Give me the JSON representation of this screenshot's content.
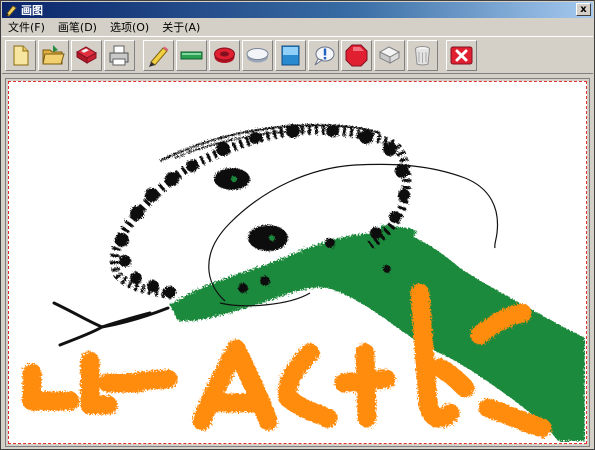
{
  "window": {
    "title": "画图",
    "close_label": "x",
    "app_icon": "brush-icon"
  },
  "menubar": {
    "items": [
      {
        "label": "文件(F)",
        "name": "menu-file"
      },
      {
        "label": "画笔(D)",
        "name": "menu-pen"
      },
      {
        "label": "选项(O)",
        "name": "menu-options"
      },
      {
        "label": "关于(A)",
        "name": "menu-about"
      }
    ]
  },
  "toolbar": {
    "buttons": [
      {
        "icon": "new-file-icon",
        "name": "new-button"
      },
      {
        "icon": "open-folder-icon",
        "name": "open-button"
      },
      {
        "icon": "save-disk-icon",
        "name": "save-button"
      },
      {
        "icon": "print-icon",
        "name": "print-button"
      },
      {
        "icon": "pencil-icon",
        "name": "pencil-tool-button"
      },
      {
        "icon": "line-icon",
        "name": "line-tool-button"
      },
      {
        "icon": "ellipse-outline-icon",
        "name": "ellipse-tool-button"
      },
      {
        "icon": "filled-ellipse-icon",
        "name": "filled-ellipse-tool-button"
      },
      {
        "icon": "rectangle-icon",
        "name": "rectangle-tool-button"
      },
      {
        "icon": "text-balloon-icon",
        "name": "text-tool-button"
      },
      {
        "icon": "polygon-icon",
        "name": "polygon-tool-button"
      },
      {
        "icon": "eraser-icon",
        "name": "eraser-tool-button"
      },
      {
        "icon": "bucket-icon",
        "name": "fill-tool-button"
      },
      {
        "icon": "clear-x-icon",
        "name": "clear-button"
      }
    ]
  },
  "colors": {
    "titlebar": "#0a246a",
    "black_ink": "#111111",
    "green_ink": "#1f8a3c",
    "orange_ink": "#ff8c0a",
    "canvas_border": "#e03030"
  }
}
